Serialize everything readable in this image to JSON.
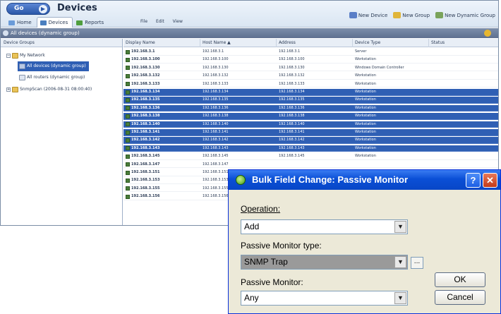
{
  "app": {
    "go_label": "Go",
    "title": "Devices",
    "tabs": [
      {
        "label": "Home",
        "icon": "home-icon",
        "color": "#6a9bd8"
      },
      {
        "label": "Devices",
        "icon": "devices-icon",
        "color": "#4a7fbf"
      },
      {
        "label": "Reports",
        "icon": "reports-icon",
        "color": "#4f9e3e"
      }
    ],
    "menus": [
      "File",
      "Edit",
      "View"
    ],
    "actions": [
      {
        "label": "New Device",
        "icon": "new-device-icon",
        "color": "#5b7fc7"
      },
      {
        "label": "New Group",
        "icon": "new-group-icon",
        "color": "#e0b53a"
      },
      {
        "label": "New Dynamic Group",
        "icon": "new-dynamic-group-icon",
        "color": "#7aa35b"
      }
    ],
    "group_bar_title": "All devices (dynamic group)"
  },
  "tree": {
    "header": "Device Groups",
    "nodes": [
      {
        "label": "My Network",
        "toggle": "−"
      },
      {
        "label": "All devices (dynamic group)",
        "selected": true
      },
      {
        "label": "All routers (dynamic group)"
      },
      {
        "label": "SnmpScan (2006-08-31 08:00:40)",
        "toggle": "+"
      }
    ]
  },
  "grid": {
    "columns": [
      "Display Name",
      "Host Name ▲",
      "Address",
      "Device Type",
      "Status"
    ],
    "rows": [
      {
        "name": "192.168.3.1",
        "host": "192.168.3.1",
        "address": "192.168.3.1",
        "type": "Server",
        "selected": false
      },
      {
        "name": "192.168.3.100",
        "host": "192.168.3.100",
        "address": "192.168.3.100",
        "type": "Workstation",
        "selected": false
      },
      {
        "name": "192.168.3.130",
        "host": "192.168.3.130",
        "address": "192.168.3.130",
        "type": "Windows Domain Controller",
        "selected": false
      },
      {
        "name": "192.168.3.132",
        "host": "192.168.3.132",
        "address": "192.168.3.132",
        "type": "Workstation",
        "selected": false
      },
      {
        "name": "192.168.3.133",
        "host": "192.168.3.133",
        "address": "192.168.3.133",
        "type": "Workstation",
        "selected": false
      },
      {
        "name": "192.168.3.134",
        "host": "192.168.3.134",
        "address": "192.168.3.134",
        "type": "Workstation",
        "selected": true
      },
      {
        "name": "192.168.3.135",
        "host": "192.168.3.135",
        "address": "192.168.3.135",
        "type": "Workstation",
        "selected": true
      },
      {
        "name": "192.168.3.136",
        "host": "192.168.3.136",
        "address": "192.168.3.136",
        "type": "Workstation",
        "selected": true
      },
      {
        "name": "192.168.3.138",
        "host": "192.168.3.138",
        "address": "192.168.3.138",
        "type": "Workstation",
        "selected": true
      },
      {
        "name": "192.168.3.140",
        "host": "192.168.3.140",
        "address": "192.168.3.140",
        "type": "Workstation",
        "selected": true
      },
      {
        "name": "192.168.3.141",
        "host": "192.168.3.141",
        "address": "192.168.3.141",
        "type": "Workstation",
        "selected": true
      },
      {
        "name": "192.168.3.142",
        "host": "192.168.3.142",
        "address": "192.168.3.142",
        "type": "Workstation",
        "selected": true
      },
      {
        "name": "192.168.3.143",
        "host": "192.168.3.143",
        "address": "192.168.3.143",
        "type": "Workstation",
        "selected": true
      },
      {
        "name": "192.168.3.145",
        "host": "192.168.3.145",
        "address": "192.168.3.145",
        "type": "Workstation",
        "selected": false
      },
      {
        "name": "192.168.3.147",
        "host": "192.168.3.147",
        "address": "",
        "type": "",
        "selected": false
      },
      {
        "name": "192.168.3.151",
        "host": "192.168.3.151",
        "address": "",
        "type": "",
        "selected": false
      },
      {
        "name": "192.168.3.153",
        "host": "192.168.3.153",
        "address": "",
        "type": "",
        "selected": false
      },
      {
        "name": "192.168.3.155",
        "host": "192.168.3.155",
        "address": "",
        "type": "",
        "selected": false
      },
      {
        "name": "192.168.3.156",
        "host": "192.168.3.156",
        "address": "",
        "type": "",
        "selected": false
      }
    ]
  },
  "dialog": {
    "title": "Bulk Field Change: Passive Monitor",
    "help": "?",
    "close": "✕",
    "operation_label": "Operation:",
    "operation_value": "Add",
    "type_label": "Passive Monitor type:",
    "type_value": "SNMP Trap",
    "browse": "...",
    "monitor_label": "Passive Monitor:",
    "monitor_value": "Any",
    "ok": "OK",
    "cancel": "Cancel"
  },
  "colors": {
    "selection": "#2f5fb4",
    "dialog_title": "#0a4fd6",
    "dialog_bg": "#ece9d8"
  }
}
